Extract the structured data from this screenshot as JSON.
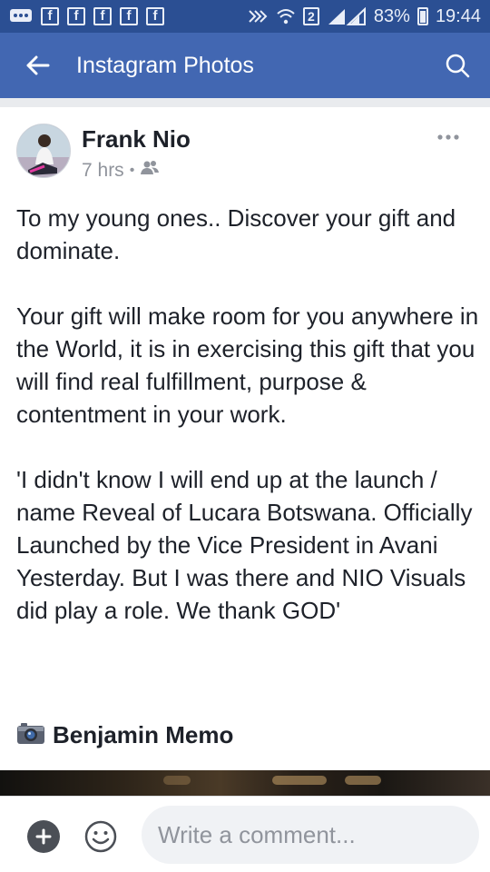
{
  "status_bar": {
    "battery": "83%",
    "time": "19:44",
    "sim_badge": "2",
    "notification_icon": "f",
    "background": "#2b4f93"
  },
  "app_bar": {
    "title": "Instagram Photos",
    "back_icon": "back-arrow-icon",
    "search_icon": "search-icon",
    "background": "#4267b2"
  },
  "post": {
    "author": "Frank Nio",
    "time": "7 hrs",
    "audience_icon": "friends-icon",
    "paragraphs": [
      "To my young ones.. Discover your gift and dominate.",
      "Your gift will make room for you anywhere in the World, it is in exercising this gift that you will find real fulfillment, purpose & contentment in your work.",
      "'I didn't know I will end up at the launch / name Reveal of  Lucara Botswana. Officially Launched by the Vice President in Avani Yesterday. But I was there and NIO Visuals did play a role. We thank GOD'"
    ],
    "credit_icon": "camera-icon",
    "credit_name": "Benjamin Memo"
  },
  "comment_bar": {
    "placeholder": "Write a comment..."
  }
}
